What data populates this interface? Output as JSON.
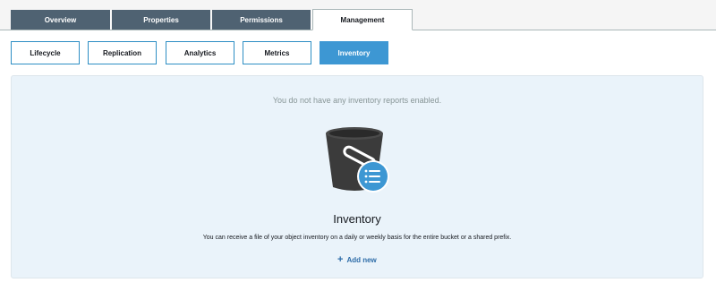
{
  "tabs": [
    {
      "label": "Overview"
    },
    {
      "label": "Properties"
    },
    {
      "label": "Permissions"
    },
    {
      "label": "Management"
    }
  ],
  "subtabs": [
    {
      "label": "Lifecycle"
    },
    {
      "label": "Replication"
    },
    {
      "label": "Analytics"
    },
    {
      "label": "Metrics"
    },
    {
      "label": "Inventory"
    }
  ],
  "panel": {
    "empty_message": "You do not have any inventory reports enabled.",
    "title": "Inventory",
    "description": "You can receive a file of your object inventory on a daily or weekly basis for the entire bucket or a shared prefix.",
    "add_label": "Add new",
    "illustration_icon": "bucket-list-icon"
  },
  "colors": {
    "tab_bg": "#4f6272",
    "accent": "#3d97d3",
    "panel_bg": "#eaf3fa",
    "link": "#2d6ca8"
  }
}
